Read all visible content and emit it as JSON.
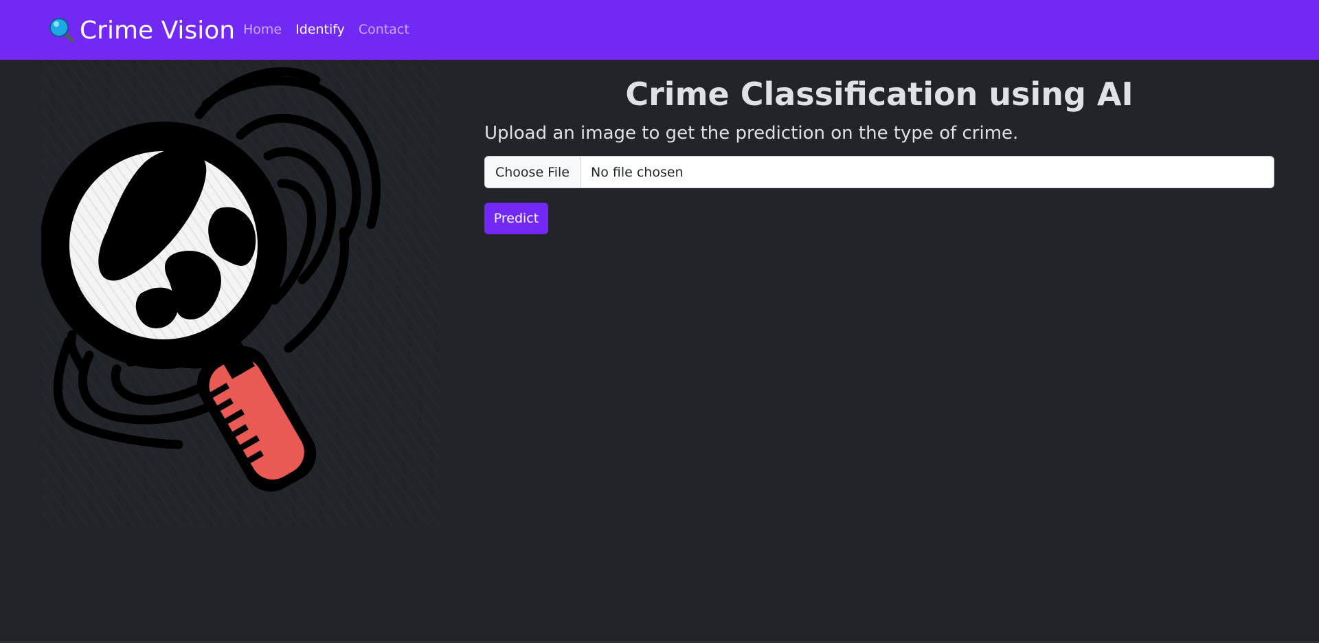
{
  "navbar": {
    "brand": "Crime Vision",
    "brand_icon": "magnifying-glass-icon",
    "links": [
      {
        "label": "Home",
        "active": false
      },
      {
        "label": "Identify",
        "active": true
      },
      {
        "label": "Contact",
        "active": false
      }
    ],
    "color": "#7229f6"
  },
  "hero": {
    "icon": "magnifying-glass-fingerprint-icon"
  },
  "main": {
    "title": "Crime Classification using AI",
    "subtitle": "Upload an image to get the prediction on the type of crime.",
    "file_input": {
      "button_label": "Choose File",
      "status": "No file chosen"
    },
    "predict_label": "Predict"
  },
  "colors": {
    "background": "#212529",
    "accent": "#7229f6",
    "text": "#dee2e6",
    "handle": "#ea5a55"
  }
}
